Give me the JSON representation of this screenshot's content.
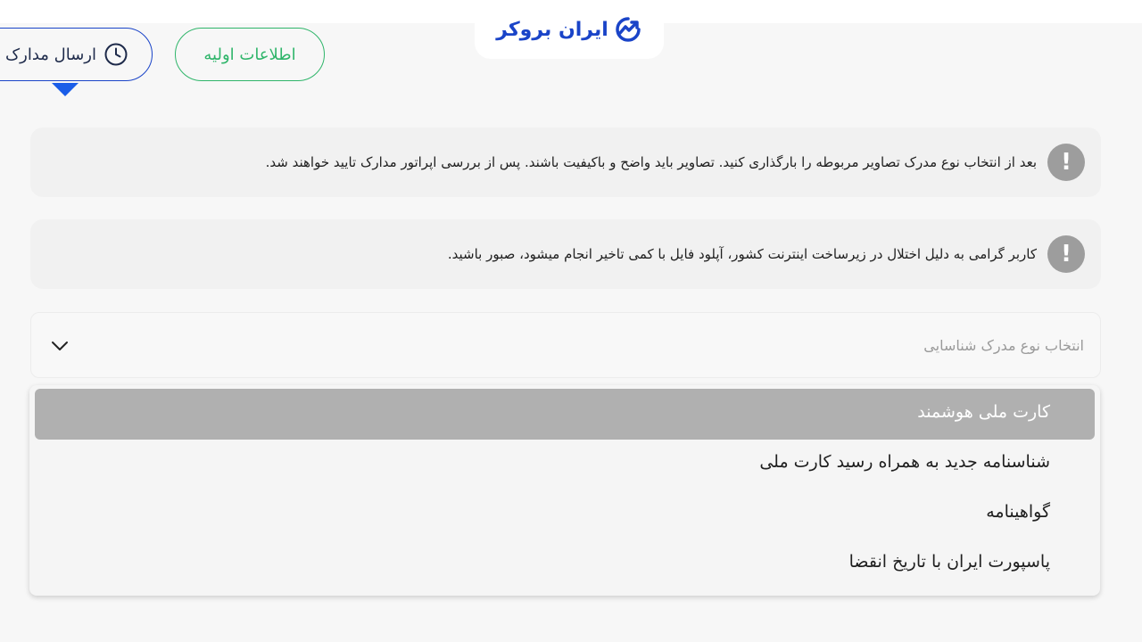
{
  "header": {
    "logo_text": "ایران بروکر",
    "logo_icon": "chart-trend-icon"
  },
  "steps": {
    "basic_info": "اطلاعات اولیه",
    "send_documents": "ارسال مدارک",
    "send_documents_icon": "clock-icon"
  },
  "notices": [
    {
      "icon": "exclamation-icon",
      "text": "بعد از انتخاب نوع مدرک تصاویر مربوطه را بارگذاری کنید. تصاویر باید واضح و باکیفیت باشند. پس از بررسی اپراتور مدارک تایید خواهند شد."
    },
    {
      "icon": "exclamation-icon",
      "text": "کاربر گرامی به دلیل اختلال در زیرساخت اینترنت کشور، آپلود فایل با کمی تاخیر انجام میشود، صبور باشید."
    }
  ],
  "document_select": {
    "placeholder": "انتخاب نوع مدرک شناسایی",
    "icon": "chevron-down-icon",
    "options": [
      "کارت ملی هوشمند",
      "شناسنامه جدید به همراه رسید کارت ملی",
      "گواهینامه",
      "پاسپورت ایران با تاریخ انقضا"
    ],
    "highlighted_option": "کارت ملی هوشمند"
  },
  "colors": {
    "brand_blue": "#1a44c8",
    "step_green": "#2fb56a",
    "notice_icon_grey": "#9d9d9d",
    "highlight_grey": "#b0b0b0"
  }
}
